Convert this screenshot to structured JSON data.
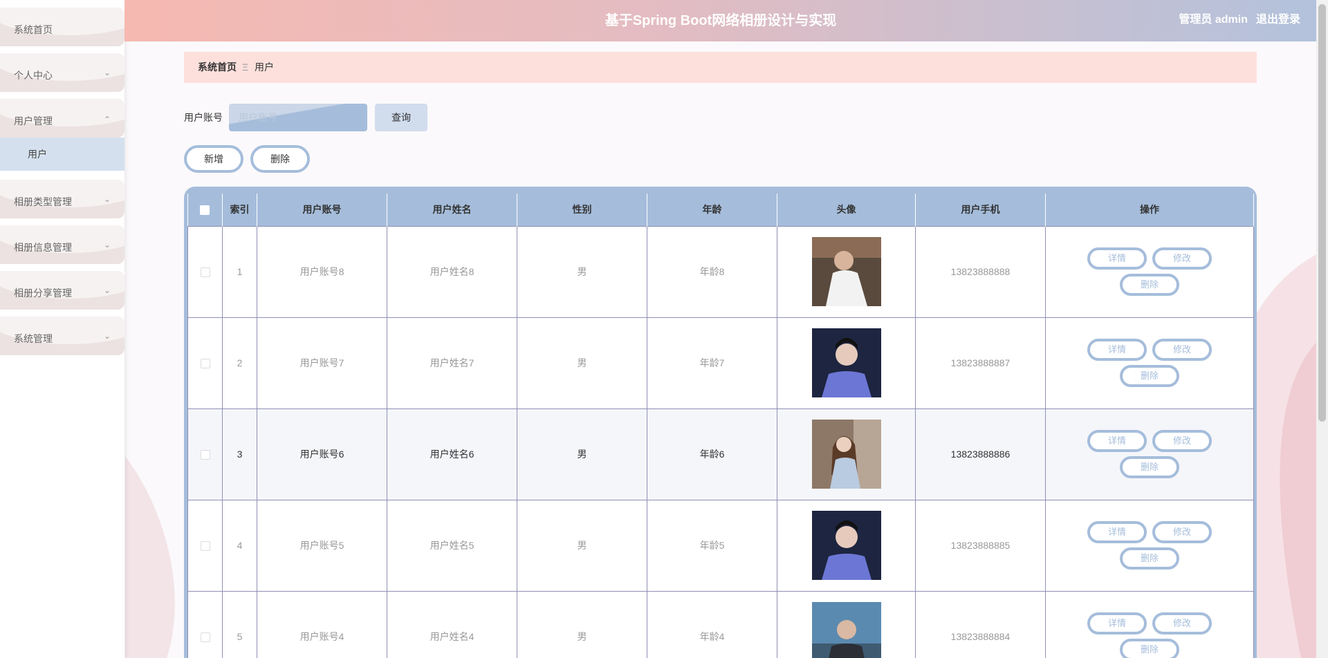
{
  "header": {
    "title": "基于Spring Boot网络相册设计与实现",
    "user_label": "管理员 admin",
    "logout": "退出登录"
  },
  "sidebar": {
    "items": [
      {
        "label": "系统首页"
      },
      {
        "label": "个人中心"
      },
      {
        "label": "用户管理"
      },
      {
        "label": "相册类型管理"
      },
      {
        "label": "相册信息管理"
      },
      {
        "label": "相册分享管理"
      },
      {
        "label": "系统管理"
      }
    ],
    "submenu_active": "用户"
  },
  "breadcrumb": {
    "home": "系统首页",
    "separator": "Ξ",
    "current": "用户"
  },
  "search": {
    "label": "用户账号",
    "placeholder": "用户账号",
    "button": "查询"
  },
  "actions": {
    "add": "新增",
    "delete": "删除"
  },
  "table": {
    "columns": [
      "索引",
      "用户账号",
      "用户姓名",
      "性别",
      "年龄",
      "头像",
      "用户手机",
      "操作"
    ],
    "rows": [
      {
        "index": "1",
        "account": "用户账号8",
        "name": "用户姓名8",
        "gender": "男",
        "age": "年龄8",
        "phone": "13823888888"
      },
      {
        "index": "2",
        "account": "用户账号7",
        "name": "用户姓名7",
        "gender": "男",
        "age": "年龄7",
        "phone": "13823888887"
      },
      {
        "index": "3",
        "account": "用户账号6",
        "name": "用户姓名6",
        "gender": "男",
        "age": "年龄6",
        "phone": "13823888886"
      },
      {
        "index": "4",
        "account": "用户账号5",
        "name": "用户姓名5",
        "gender": "男",
        "age": "年龄5",
        "phone": "13823888885"
      },
      {
        "index": "5",
        "account": "用户账号4",
        "name": "用户姓名4",
        "gender": "男",
        "age": "年龄4",
        "phone": "13823888884"
      }
    ],
    "op_detail": "详情",
    "op_edit": "修改",
    "op_delete": "删除"
  },
  "colors": {
    "accent": "#a5bddb",
    "breadcrumb_bg": "#fde0dc",
    "menu_bg": "#ebe2e1"
  }
}
